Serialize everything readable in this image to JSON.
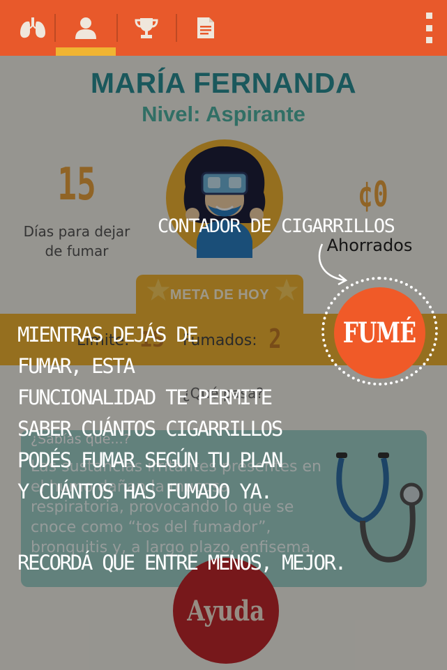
{
  "nav": {
    "tabs": [
      {
        "icon": "lungs-icon"
      },
      {
        "icon": "user-icon",
        "active": true
      },
      {
        "icon": "trophy-icon"
      },
      {
        "icon": "document-icon"
      }
    ],
    "menu_icon": "more-vertical-icon"
  },
  "profile": {
    "name": "MARÍA FERNANDA",
    "level": "Nivel: Aspirante",
    "days_value": "15",
    "days_label": "Días para dejar de fumar",
    "saved_value": "¢0",
    "saved_label": "Ahorrados"
  },
  "goal": {
    "title": "META DE HOY",
    "limit_label": "Límite:",
    "limit_value": "15",
    "smoked_label": "Fumados:",
    "smoked_value": "2"
  },
  "tip": {
    "heading": "¿Qué pasa?",
    "card_title": "¿Sabías que...?",
    "text": "Las sustancias irritantes presentes en el humo dañan la mucosa respiratoria, provocando lo que se cnoce como “tos del fumador”, bronquitis y, a largo plazo, enfisema."
  },
  "help_button": "Ayuda",
  "tour": {
    "title": "CONTADOR DE CIGARRILLOS",
    "button_label": "FUMÉ",
    "lines": [
      "MIENTRAS DEJÁS DE",
      "FUMAR, ESTA",
      "FUNCIONALIDAD TE PERMITE",
      "SABER CUÁNTOS CIGARRILLOS",
      "PODÉS FUMAR SEGÚN TU PLAN",
      "Y CUÁNTOS HAS FUMADO YA."
    ],
    "footnote": "RECORDÁ QUE ENTRE MENOS, MEJOR."
  },
  "colors": {
    "topbar": "#e8592b",
    "accent_yellow": "#f0b432",
    "teal_title": "#2a8e95",
    "fume_orange": "#f05a28",
    "help_red": "#c1272d"
  }
}
